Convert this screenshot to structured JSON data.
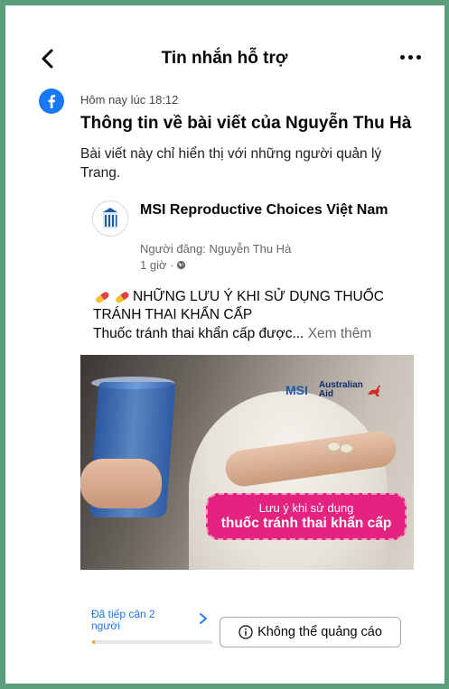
{
  "header": {
    "title": "Tin nhắn hỗ trợ"
  },
  "message": {
    "timestamp": "Hôm nay lúc 18:12",
    "heading": "Thông tin về bài viết của Nguyễn Thu Hà",
    "description": "Bài viết này chỉ hiển thị với những người quản lý Trang."
  },
  "post": {
    "page_name": "MSI Reproductive Choices Việt Nam",
    "poster": "Người đăng: Nguyễn Thu Hà",
    "time": "1 giờ ·",
    "text_line1": "NHỮNG LƯU Ý KHI SỬ DỤNG THUỐC",
    "text_line2": "TRÁNH THAI KHẨN CẤP",
    "text_line3": "Thuốc tránh thai khẩn cấp được...",
    "see_more": "Xem thêm",
    "image": {
      "logo_msi": "MSI",
      "logo_aus_line1": "Australian",
      "logo_aus_line2": "Aid",
      "overlay_top": "Lưu ý khi sử dụng",
      "overlay_bottom": "thuốc tránh thai khẩn cấp"
    }
  },
  "footer": {
    "reach_label": "Đã tiếp cận 2 người",
    "reach_progress": 0.02,
    "no_ads_label": "Không thể quảng cáo"
  },
  "colors": {
    "frame": "#5a9e7c",
    "link": "#1877f2",
    "badge": "#e3237f",
    "progress": "#f0a033"
  },
  "icons": {
    "back": "chevron-left-icon",
    "more": "more-horizontal-icon",
    "facebook": "facebook-icon",
    "globe": "globe-icon",
    "pill": "pill-icon",
    "chevron": "chevron-right-icon",
    "info": "info-icon"
  }
}
